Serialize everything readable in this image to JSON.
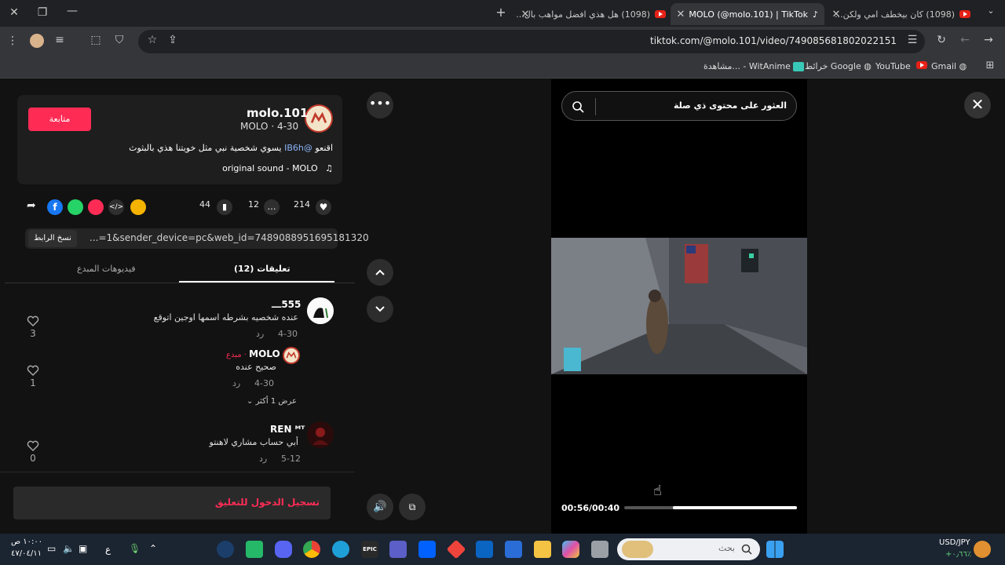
{
  "browser": {
    "tabs": [
      {
        "title": "(1098) كان بيخطف امي ولكن...",
        "active": false
      },
      {
        "title": "MOLO (@molo.101) | TikTok",
        "active": true
      },
      {
        "title": "(1098) هل هذي افضل مواهب بال...",
        "active": false
      }
    ],
    "url": "tiktok.com/@molo.101/video/7490856818020221 51",
    "url_full": "tiktok.com/@molo.101/video/7490856818020221​51",
    "bookmarks": [
      {
        "label": "Gmail"
      },
      {
        "label": "YouTube"
      },
      {
        "label": "خرائط Google"
      },
      {
        "label": "مشاهدة... - WitAnime"
      }
    ]
  },
  "post": {
    "username": "molo.101",
    "subline": "MOLO · 4-30",
    "follow_label": "متابعة",
    "caption_pre": "اقنعو",
    "caption_mention": "@IB6h",
    "caption_post": "يسوي شخصية نبي مثل خويتنا هذي بالبثوث",
    "sound": "original sound - MOLO",
    "likes": "214",
    "comments": "12",
    "saves": "44",
    "link_text": "...=1&sender_device=pc&web_id=7489088951695181320",
    "copy_link_label": "نسخ الرابط"
  },
  "comment_tabs": {
    "comments": "تعليقات (12)",
    "creator_videos": "فيديوهات المبدع"
  },
  "comments": [
    {
      "name": "555ـــ",
      "text": "عنده شخصيه بشرطه اسمها اوجين اتوقع",
      "date": "4-30",
      "reply": "رد",
      "likes": "3"
    },
    {
      "name": "MOLO",
      "creator_tag": "مبدع · ",
      "text": "صحيح عنده",
      "date": "4-30",
      "reply": "رد",
      "likes": "1"
    },
    {
      "name": "REN ᴹᵀ",
      "text": "أبي حساب مشاري لاهنتو",
      "date": "5-12",
      "reply": "رد",
      "likes": "0"
    }
  ],
  "view_more": "عرض 1 أكثر",
  "login_prompt": "تسجيل الدخول للتعليق",
  "video": {
    "search_placeholder": "العثور على محتوى ذي صلة",
    "time": "00:56/00:40",
    "progress": 0.72
  },
  "taskbar": {
    "search_placeholder": "بحث",
    "currency": "USD/JPY",
    "currency_change": "+٠٫٦٦٪",
    "time": "١٠:٠٠ ص",
    "date": "٤٧/٠٤/١١",
    "lang": "ع"
  }
}
